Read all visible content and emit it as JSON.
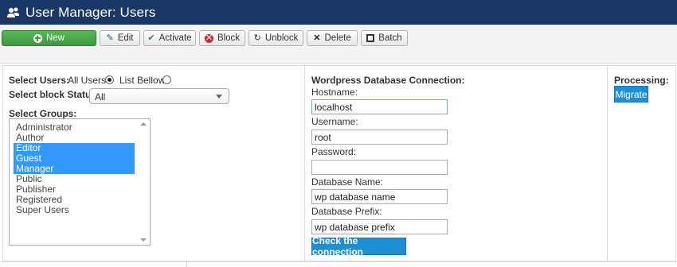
{
  "header": {
    "title": "User Manager: Users",
    "icon": "users-icon"
  },
  "toolbar": {
    "new": "New",
    "edit": "Edit",
    "activate": "Activate",
    "block": "Block",
    "unblock": "Unblock",
    "delete": "Delete",
    "batch": "Batch"
  },
  "users": {
    "select_users_label": "Select Users:",
    "all_users": "All Users",
    "list_bellow": "List Bellow",
    "selected": "All Users",
    "block_status_label": "Select block Status:",
    "block_status_value": "All",
    "groups_label": "Select Groups:",
    "groups": [
      {
        "label": "Administrator",
        "selected": false
      },
      {
        "label": "Author",
        "selected": false
      },
      {
        "label": "Editor",
        "selected": true
      },
      {
        "label": "Guest",
        "selected": true
      },
      {
        "label": "Manager",
        "selected": true
      },
      {
        "label": "Public",
        "selected": false
      },
      {
        "label": "Publisher",
        "selected": false
      },
      {
        "label": "Registered",
        "selected": false
      },
      {
        "label": "Super Users",
        "selected": false
      }
    ]
  },
  "wp": {
    "heading": "Wordpress Database Connection:",
    "hostname_label": "Hostname:",
    "hostname_value": "localhost",
    "username_label": "Username:",
    "username_value": "root",
    "password_label": "Password:",
    "password_value": "",
    "dbname_label": "Database Name:",
    "dbname_value": "wp database name",
    "prefix_label": "Database Prefix:",
    "prefix_value": "wp database prefix",
    "check_button": "Check the connection"
  },
  "processing": {
    "heading": "Processing:",
    "migrate_button": "Migrate"
  },
  "colors": {
    "header_bg": "#1a3867",
    "new_button": "#3c9a3c",
    "primary_blue": "#1f8fd3",
    "selection": "#3399ff"
  }
}
